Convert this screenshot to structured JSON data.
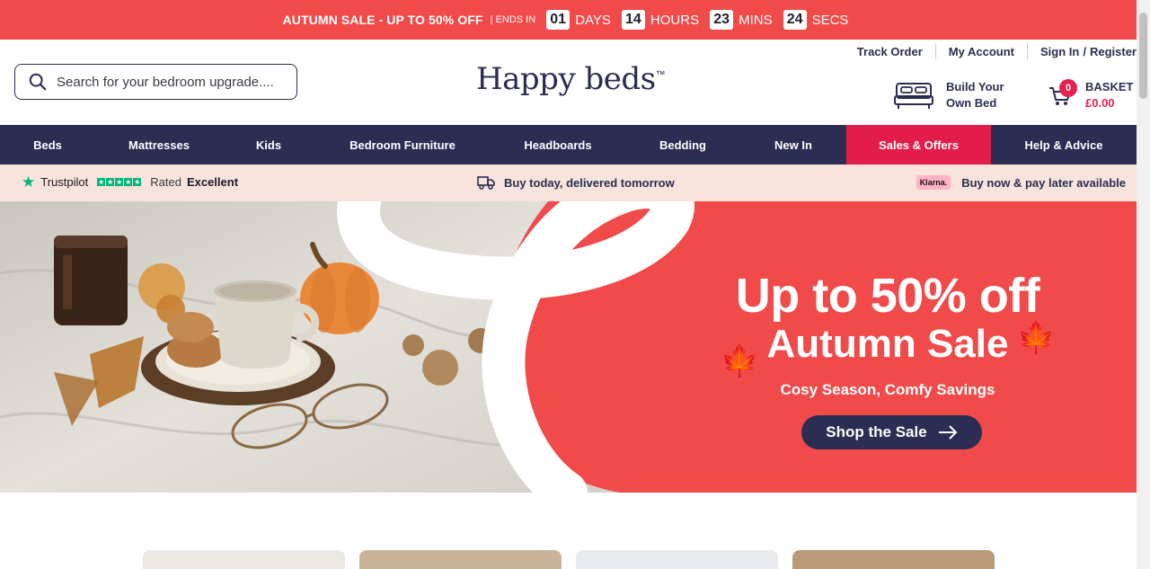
{
  "promo": {
    "sale_text": "AUTUMN SALE - UP TO 50% OFF",
    "separator": "|",
    "ends_in": "ENDS IN",
    "countdown": [
      {
        "value": "01",
        "unit": "DAYS"
      },
      {
        "value": "14",
        "unit": "HOURS"
      },
      {
        "value": "23",
        "unit": "MINS"
      },
      {
        "value": "24",
        "unit": "SECS"
      }
    ]
  },
  "header": {
    "search_placeholder": "Search for your bedroom upgrade....",
    "logo": "Happy beds",
    "logo_tm": "™",
    "links": {
      "track_order": "Track Order",
      "my_account": "My Account",
      "sign_in": "Sign In",
      "slash": "/",
      "register": "Register"
    },
    "build_line1": "Build Your",
    "build_line2": "Own Bed",
    "basket_count": "0",
    "basket_label": "BASKET",
    "basket_total": "£0.00"
  },
  "nav": {
    "items": [
      {
        "label": "Beds"
      },
      {
        "label": "Mattresses"
      },
      {
        "label": "Kids"
      },
      {
        "label": "Bedroom Furniture"
      },
      {
        "label": "Headboards"
      },
      {
        "label": "Bedding"
      },
      {
        "label": "New In"
      },
      {
        "label": "Sales & Offers"
      },
      {
        "label": "Help & Advice"
      }
    ]
  },
  "usp": {
    "trustpilot": "Trustpilot",
    "rated": "Rated",
    "rating": "Excellent",
    "delivery": "Buy today, delivered tomorrow",
    "klarna_badge": "Klarna.",
    "klarna_text": "Buy now & pay later available"
  },
  "hero": {
    "headline": "Up to 50% off",
    "subheadline": "Autumn Sale",
    "tagline": "Cosy Season, Comfy Savings",
    "cta": "Shop the Sale"
  },
  "colors": {
    "promo_red": "#f04a4a",
    "navy": "#2b2d52",
    "sale_pink": "#e31d4a",
    "usp_bg": "#f8e3dd",
    "trustpilot_green": "#00b67a"
  }
}
